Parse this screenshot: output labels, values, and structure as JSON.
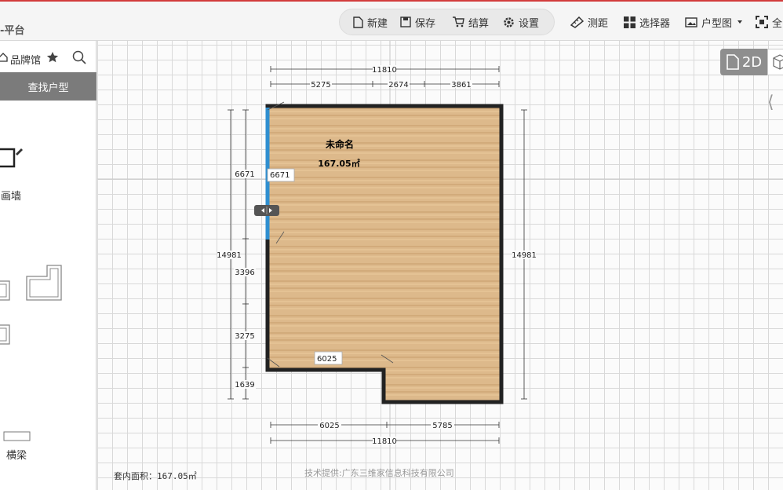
{
  "toolbar": {
    "brand": "-平台",
    "items": [
      {
        "label": "新建",
        "icon": "file-icon"
      },
      {
        "label": "保存",
        "icon": "save-icon"
      },
      {
        "label": "结算",
        "icon": "cart-icon"
      },
      {
        "label": "设置",
        "icon": "gear-icon"
      },
      {
        "label": "测距",
        "icon": "ruler-icon"
      },
      {
        "label": "选择器",
        "icon": "grid-icon"
      },
      {
        "label": "户型图",
        "icon": "image-icon"
      },
      {
        "label": "全",
        "icon": "fullscreen-icon"
      }
    ]
  },
  "sidebar": {
    "brand_hall": "品牌馆",
    "find_button": "查找户型",
    "draw_wall": "画墙",
    "beam": "横梁"
  },
  "view": {
    "mode_2d": "2D"
  },
  "plan": {
    "room_name": "未命名",
    "room_area": "167.05㎡",
    "dims": {
      "top_total": "11810",
      "top_a": "5275",
      "top_b": "2674",
      "top_c": "3861",
      "left_total": "14981",
      "left_a": "6671",
      "left_b": "3396",
      "left_c": "3275",
      "left_d": "1639",
      "right_total": "14981",
      "bottom_a": "6025",
      "bottom_b": "5785",
      "bottom_total": "11810",
      "wall_label": "6671",
      "inner_label": "6025"
    }
  },
  "footer": {
    "area_text": "套内面积：167.05㎡",
    "credit": "技术提供:广东三维家信息科技有限公司"
  }
}
